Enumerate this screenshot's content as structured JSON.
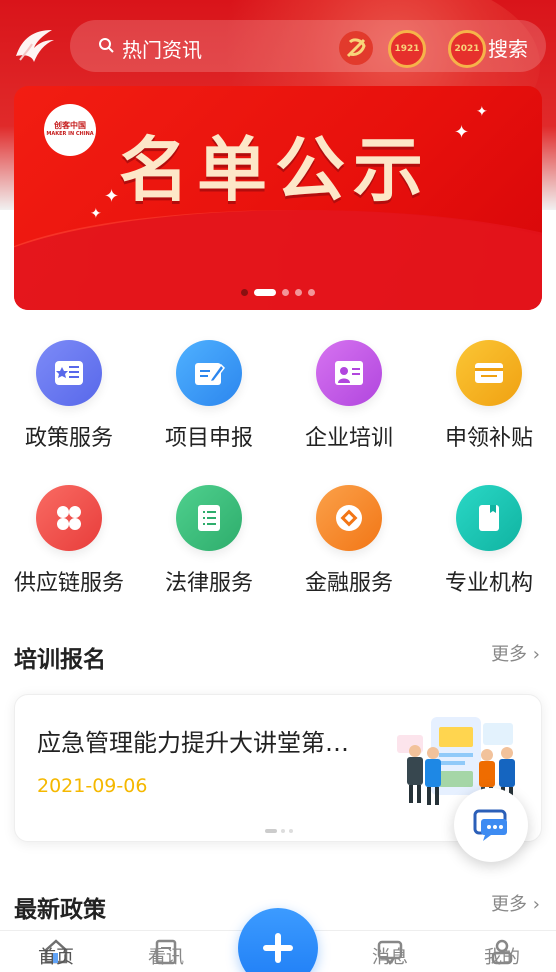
{
  "header": {
    "search_placeholder": "热门资讯",
    "search_button": "搜索",
    "badge_1": "1921",
    "badge_2": "2021"
  },
  "banner": {
    "title": "名单公示",
    "logo_text": "创客中国",
    "logo_subtext": "MAKER IN CHINA",
    "slides_count": 5,
    "active_slide": 2
  },
  "grid": {
    "items": [
      {
        "label": "政策服务",
        "icon": "policy-icon",
        "color": "#6b7bf2"
      },
      {
        "label": "项目申报",
        "icon": "project-icon",
        "color": "#3d9bf5"
      },
      {
        "label": "企业培训",
        "icon": "training-icon",
        "color": "#c65ae6"
      },
      {
        "label": "申领补贴",
        "icon": "subsidy-icon",
        "color": "#f5b41b"
      },
      {
        "label": "供应链服务",
        "icon": "supply-chain-icon",
        "color": "#f0544f"
      },
      {
        "label": "法律服务",
        "icon": "legal-icon",
        "color": "#3cc07d"
      },
      {
        "label": "金融服务",
        "icon": "finance-icon",
        "color": "#f7882e"
      },
      {
        "label": "专业机构",
        "icon": "institution-icon",
        "color": "#1cc8b5"
      }
    ]
  },
  "training": {
    "title": "培训报名",
    "more": "更多",
    "card_title": "应急管理能力提升大讲堂第…",
    "card_date": "2021-09-06"
  },
  "policy": {
    "title": "最新政策",
    "more": "更多"
  },
  "tabbar": {
    "tabs": [
      {
        "label": "首页",
        "icon": "home-icon"
      },
      {
        "label": "看讯",
        "icon": "news-icon"
      },
      {
        "label": "消息",
        "icon": "message-icon"
      },
      {
        "label": "我的",
        "icon": "profile-icon"
      }
    ]
  },
  "colors": {
    "primary_red": "#e02a2a",
    "accent_blue": "#1e7df5",
    "date_yellow": "#f5b800"
  }
}
